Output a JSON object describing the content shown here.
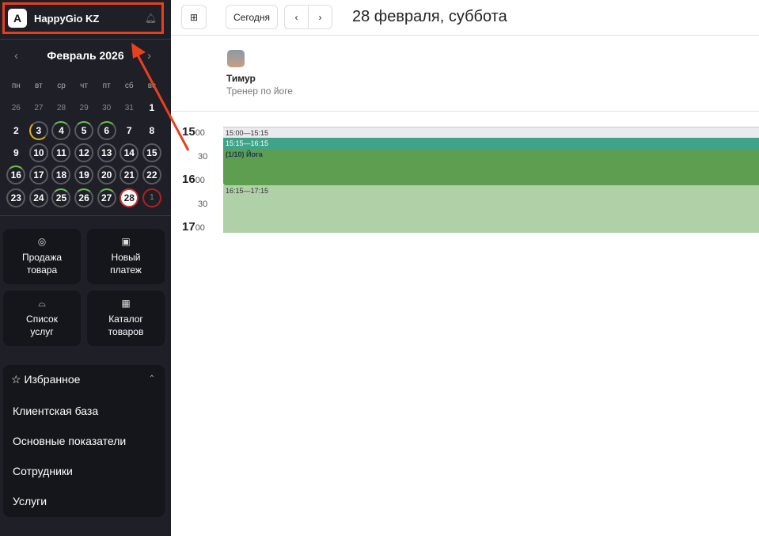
{
  "sidebar": {
    "brand": "HappyGio KZ",
    "logo_letter": "A",
    "month": "Февраль 2026",
    "weekdays": [
      "пн",
      "вт",
      "ср",
      "чт",
      "пт",
      "сб",
      "вс"
    ],
    "days": [
      {
        "d": "26",
        "k": "o"
      },
      {
        "d": "27",
        "k": "o"
      },
      {
        "d": "28",
        "k": "o"
      },
      {
        "d": "29",
        "k": "o"
      },
      {
        "d": "30",
        "k": "o"
      },
      {
        "d": "31",
        "k": "o"
      },
      {
        "d": "1",
        "k": "p"
      },
      {
        "d": "2",
        "k": "p"
      },
      {
        "d": "3",
        "k": "y"
      },
      {
        "d": "4",
        "k": "g"
      },
      {
        "d": "5",
        "k": "g"
      },
      {
        "d": "6",
        "k": "g"
      },
      {
        "d": "7",
        "k": "p"
      },
      {
        "d": "8",
        "k": "p"
      },
      {
        "d": "9",
        "k": "p"
      },
      {
        "d": "10",
        "k": "r"
      },
      {
        "d": "11",
        "k": "r"
      },
      {
        "d": "12",
        "k": "r"
      },
      {
        "d": "13",
        "k": "r"
      },
      {
        "d": "14",
        "k": "r"
      },
      {
        "d": "15",
        "k": "r"
      },
      {
        "d": "16",
        "k": "g"
      },
      {
        "d": "17",
        "k": "r"
      },
      {
        "d": "18",
        "k": "r"
      },
      {
        "d": "19",
        "k": "r"
      },
      {
        "d": "20",
        "k": "r"
      },
      {
        "d": "21",
        "k": "r"
      },
      {
        "d": "22",
        "k": "r"
      },
      {
        "d": "23",
        "k": "r"
      },
      {
        "d": "24",
        "k": "r"
      },
      {
        "d": "25",
        "k": "g"
      },
      {
        "d": "26",
        "k": "g"
      },
      {
        "d": "27",
        "k": "g"
      },
      {
        "d": "28",
        "k": "sel"
      },
      {
        "d": "1",
        "k": "red"
      }
    ],
    "actions": [
      {
        "label": "Продажа товара",
        "icon": "target-icon"
      },
      {
        "label": "Новый платеж",
        "icon": "payment-icon"
      },
      {
        "label": "Список услуг",
        "icon": "service-bell-icon"
      },
      {
        "label": "Каталог товаров",
        "icon": "boxes-icon"
      }
    ],
    "favorites": {
      "title": "Избранное",
      "items": [
        "Клиентская база",
        "Основные показатели",
        "Сотрудники",
        "Услуги"
      ]
    }
  },
  "header": {
    "today": "Сегодня",
    "prev": "‹",
    "next": "›",
    "date": "28 февраля, суббота"
  },
  "employee": {
    "name": "Тимур",
    "role": "Тренер по йоге"
  },
  "times": [
    {
      "h": "15",
      "m": "00"
    },
    {
      "h": "",
      "m": "30"
    },
    {
      "h": "16",
      "m": "00"
    },
    {
      "h": "",
      "m": "30"
    },
    {
      "h": "17",
      "m": "00"
    }
  ],
  "events": [
    {
      "time": "15:00—15:15",
      "color": "#eaeaef"
    },
    {
      "time": "15:15—16:15",
      "title": "(1/10) Йога",
      "color": "#5e9e50",
      "header_color": "#3fa38a"
    },
    {
      "time": "16:15—17:15",
      "color": "#b0d0a8"
    }
  ],
  "colors": {
    "accent_highlight": "#e8401c",
    "sidebar": "#1f2027"
  }
}
